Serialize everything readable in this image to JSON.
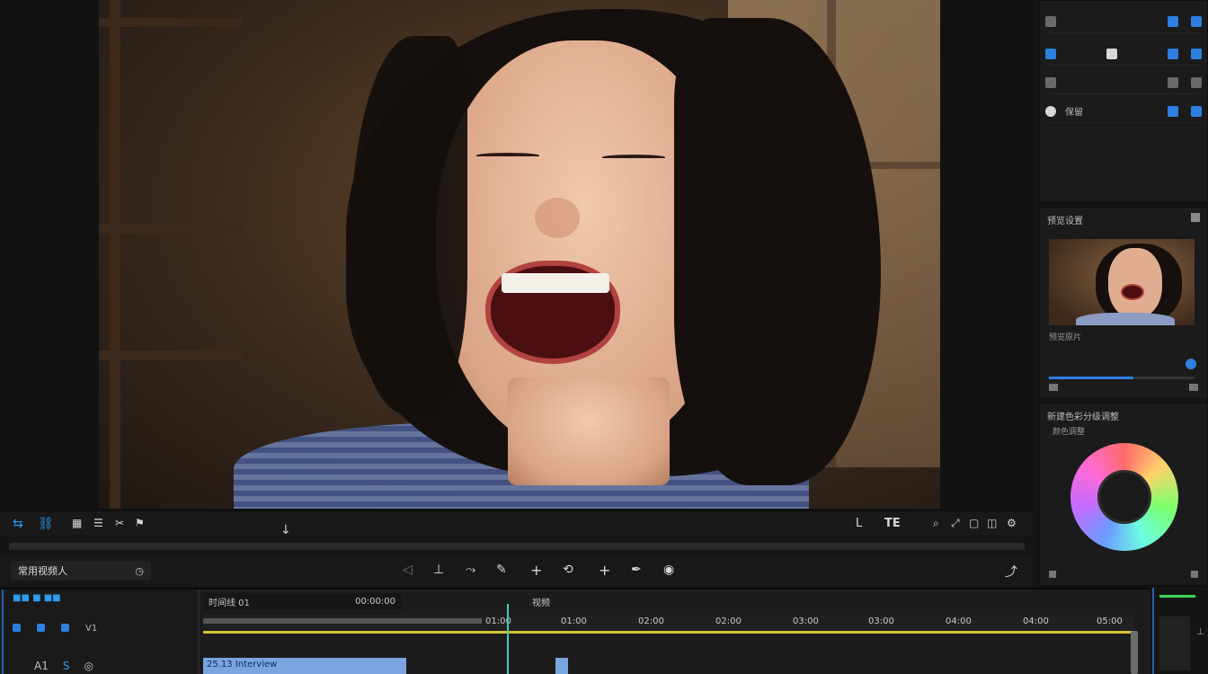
{
  "viewer": {
    "controls_left": [
      "sync-icon",
      "link-icon",
      "grid-icon",
      "list-icon",
      "clip-icon"
    ],
    "controls_right_labels": [
      "L",
      "TE"
    ],
    "track_name_field": "常用视频人",
    "bottom_tools": [
      "select-tool",
      "trim-tool",
      "razor-tool",
      "add-tool",
      "slip-tool",
      "add-tool",
      "pen-tool",
      "color-tool",
      "export-tool"
    ]
  },
  "right_panel": {
    "rows": [
      {
        "label": ""
      },
      {
        "label": ""
      },
      {
        "label": ""
      },
      {
        "label": "保留"
      }
    ],
    "preview_title": "预览设置",
    "preview_caption": "预览原片",
    "color_title": "新建色彩分级调整",
    "color_sub": "颜色调整"
  },
  "timeline": {
    "header": {
      "left_label": "时间线 01",
      "mid_label": "00:00:00",
      "right_label": "视频"
    },
    "ruler": [
      "01:00",
      "01:00",
      "02:00",
      "02:00",
      "03:00",
      "03:00",
      "04:00",
      "04:00",
      "05:00"
    ],
    "clip_label": "25.13 Interview",
    "tracks": [
      "V1",
      "A1"
    ]
  },
  "colors": {
    "accent": "#2d7fe0",
    "playhead": "#3ccfc0",
    "marker_bar": "#d6c133",
    "clip": "#7aa5e0"
  }
}
